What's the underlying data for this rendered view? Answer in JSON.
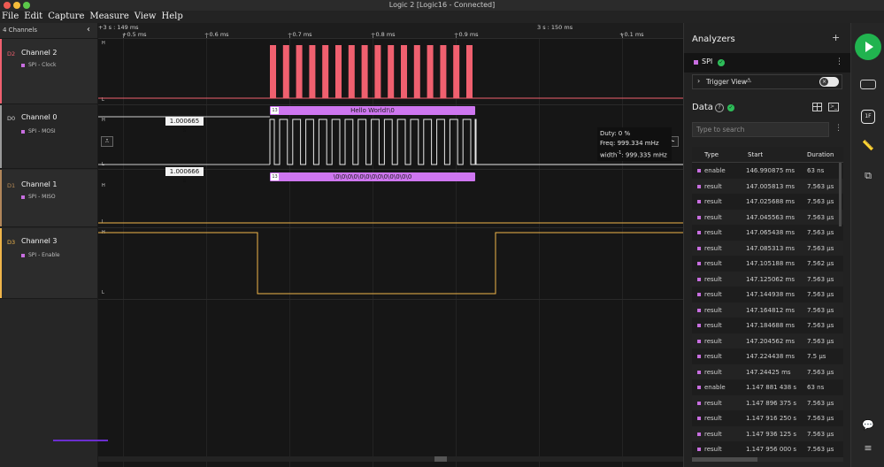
{
  "window": {
    "title": "Logic 2 [Logic16 - Connected]"
  },
  "menu": [
    "File",
    "Edit",
    "Capture",
    "Measure",
    "View",
    "Help"
  ],
  "channel_panel": {
    "count_label": "4 Channels",
    "channels": [
      {
        "id": "D2",
        "name": "Channel 2",
        "analyzer": "SPI - Clock",
        "color": "#f0606f"
      },
      {
        "id": "D0",
        "name": "Channel 0",
        "analyzer": "SPI - MOSI",
        "color": "#ffffff"
      },
      {
        "id": "D1",
        "name": "Channel 1",
        "analyzer": "SPI - MISO",
        "color": "#f0b54a"
      },
      {
        "id": "D3",
        "name": "Channel 3",
        "analyzer": "SPI - Enable",
        "color": "#f0b54a"
      }
    ]
  },
  "ruler": {
    "left_label": "+3 s : 149 ms",
    "center_label": "3 s : 150 ms",
    "ticks": [
      "+0.5 ms",
      "+0.6 ms",
      "+0.7 ms",
      "+0.8 ms",
      "+0.9 ms",
      "+0.1 ms"
    ]
  },
  "waveform": {
    "level_high": "H",
    "level_low": "L",
    "mosi_frame": {
      "index": "13",
      "text": "Hello World!\\0"
    },
    "miso_frame": {
      "index": "13",
      "text": "\\0\\0\\0\\0\\0\\0\\0\\0\\0\\0\\0\\0\\0"
    },
    "measure_top": "1.000665 s",
    "measure_bottom": "1.000666 s",
    "tooltip": {
      "duty": "Duty: 0 %",
      "freq": "Freq: 999.334 mHz",
      "width_prefix": "width",
      "width_sup": "-1",
      "width_value": ": 999.335 mHz"
    }
  },
  "analyzers": {
    "title": "Analyzers",
    "add_icon": "+",
    "active": {
      "name": "SPI",
      "status": "ok"
    },
    "trigger_view_label": "Trigger View"
  },
  "data_panel": {
    "title": "Data",
    "search_placeholder": "Type to search",
    "columns": [
      "Type",
      "Start",
      "Duration"
    ],
    "rows": [
      {
        "type": "enable",
        "start": "146.990875 ms",
        "duration": "63 ns"
      },
      {
        "type": "result",
        "start": "147.005813 ms",
        "duration": "7.563 µs"
      },
      {
        "type": "result",
        "start": "147.025688 ms",
        "duration": "7.563 µs"
      },
      {
        "type": "result",
        "start": "147.045563 ms",
        "duration": "7.563 µs"
      },
      {
        "type": "result",
        "start": "147.065438 ms",
        "duration": "7.563 µs"
      },
      {
        "type": "result",
        "start": "147.085313 ms",
        "duration": "7.563 µs"
      },
      {
        "type": "result",
        "start": "147.105188 ms",
        "duration": "7.562 µs"
      },
      {
        "type": "result",
        "start": "147.125062 ms",
        "duration": "7.563 µs"
      },
      {
        "type": "result",
        "start": "147.144938 ms",
        "duration": "7.563 µs"
      },
      {
        "type": "result",
        "start": "147.164812 ms",
        "duration": "7.563 µs"
      },
      {
        "type": "result",
        "start": "147.184688 ms",
        "duration": "7.563 µs"
      },
      {
        "type": "result",
        "start": "147.204562 ms",
        "duration": "7.563 µs"
      },
      {
        "type": "result",
        "start": "147.224438 ms",
        "duration": "7.5 µs"
      },
      {
        "type": "result",
        "start": "147.24425 ms",
        "duration": "7.563 µs"
      },
      {
        "type": "enable",
        "start": "1.147 881 438 s",
        "duration": "63 ns"
      },
      {
        "type": "result",
        "start": "1.147 896 375 s",
        "duration": "7.563 µs"
      },
      {
        "type": "result",
        "start": "1.147 916 250 s",
        "duration": "7.563 µs"
      },
      {
        "type": "result",
        "start": "1.147 936 125 s",
        "duration": "7.563 µs"
      },
      {
        "type": "result",
        "start": "1.147 956 000 s",
        "duration": "7.563 µs"
      }
    ]
  },
  "colors": {
    "clock": "#f0606f",
    "mosi": "#ffffff",
    "enable": "#f0b54a",
    "analyzer": "#ce76f0",
    "accent_green": "#21b34f"
  }
}
